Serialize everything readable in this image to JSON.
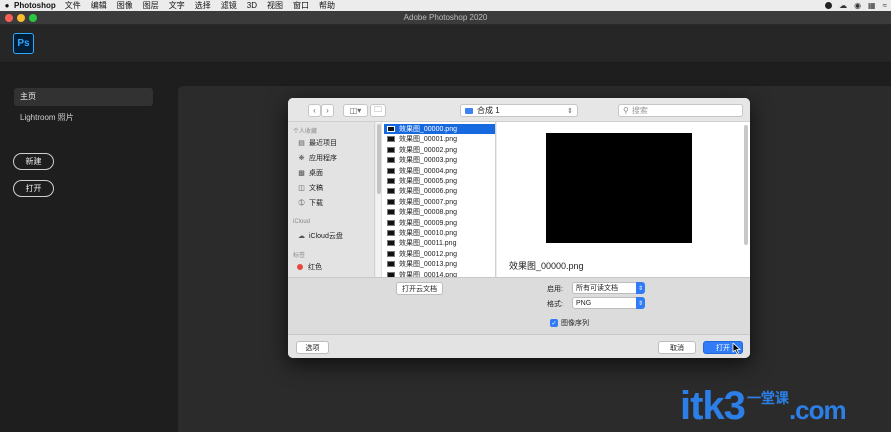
{
  "menubar": {
    "app_name": "Photoshop",
    "items": [
      "文件",
      "编辑",
      "图像",
      "图层",
      "文字",
      "选择",
      "滤镜",
      "3D",
      "视图",
      "窗口",
      "帮助"
    ]
  },
  "window": {
    "title": "Adobe Photoshop 2020"
  },
  "app": {
    "logo_text": "Ps"
  },
  "sidebar": {
    "home_label": "主页",
    "lightroom_label": "Lightroom 照片",
    "new_button": "新建",
    "open_button": "打开"
  },
  "dialog": {
    "location": "合成 1",
    "search_placeholder": "搜索",
    "sidebar": {
      "favorites_heading": "个人收藏",
      "favorites": [
        "最近项目",
        "应用程序",
        "桌面",
        "文稿",
        "下载"
      ],
      "icloud_heading": "iCloud",
      "icloud_items": [
        "iCloud云盘"
      ],
      "tags_heading": "标签",
      "tags": [
        "红色"
      ]
    },
    "files": [
      "效果图_00000.png",
      "效果图_00001.png",
      "效果图_00002.png",
      "效果图_00003.png",
      "效果图_00004.png",
      "效果图_00005.png",
      "效果图_00006.png",
      "效果图_00007.png",
      "效果图_00008.png",
      "效果图_00009.png",
      "效果图_00010.png",
      "效果图_00011.png",
      "效果图_00012.png",
      "效果图_00013.png",
      "效果图_00014.png"
    ],
    "selected_index": 0,
    "preview_name": "效果图_00000.png",
    "open_cloud_button": "打开云文档",
    "enable_label": "启用:",
    "enable_value": "所有可读文档",
    "format_label": "格式:",
    "format_value": "PNG",
    "sequence_label": "图像序列",
    "sequence_checked": true,
    "options_button": "选项",
    "cancel_button": "取消",
    "open_button": "打开"
  },
  "watermark": {
    "main": "itk3",
    "sub": "一堂课",
    "domain": ".com"
  },
  "colors": {
    "accent": "#2f7cf6",
    "ps_blue": "#31a8ff",
    "watermark": "#2d7fe8"
  }
}
